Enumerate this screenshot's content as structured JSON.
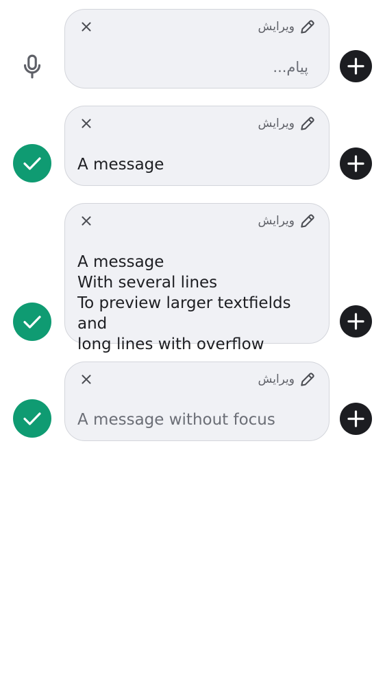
{
  "composers": [
    {
      "edit_label": "ویرایش",
      "placeholder": "پیام...",
      "text": "",
      "left_action": "mic-icon",
      "focused": true
    },
    {
      "edit_label": "ویرایش",
      "text": "A message",
      "left_action": "check-icon",
      "focused": true
    },
    {
      "edit_label": "ویرایش",
      "text": "A message\nWith several lines\nTo preview larger textfields and\nlong lines with overflow",
      "left_action": "check-icon",
      "focused": true
    },
    {
      "edit_label": "ویرایش",
      "text": "A message without focus",
      "left_action": "check-icon",
      "focused": false
    }
  ],
  "colors": {
    "bubble_bg": "#f0f1f5",
    "bubble_border": "#d3d5db",
    "send_accent": "#0f9b72",
    "plus_bg": "#1c1d21",
    "text_primary": "#1d1e22",
    "text_muted": "#6b6e76"
  }
}
